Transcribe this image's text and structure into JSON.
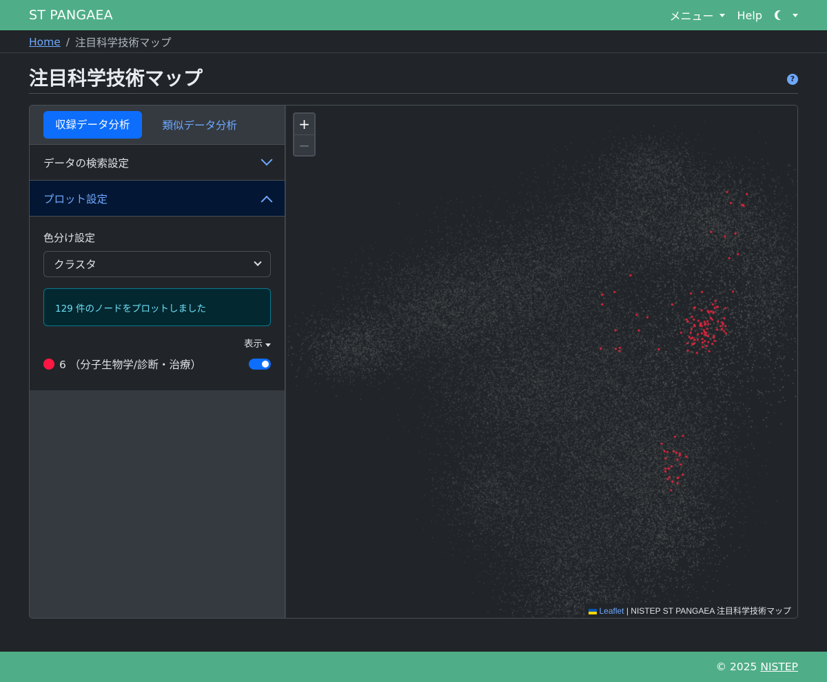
{
  "navbar": {
    "brand": "ST PANGAEA",
    "menu_label": "メニュー",
    "help_label": "Help",
    "theme_icon": "moon-icon"
  },
  "breadcrumb": {
    "home": "Home",
    "separator": "/",
    "current": "注目科学技術マップ"
  },
  "page": {
    "title": "注目科学技術マップ",
    "help_icon": "question-circle-icon",
    "help_glyph": "?"
  },
  "sidebar": {
    "tabs": [
      {
        "label": "収録データ分析",
        "active": true
      },
      {
        "label": "類似データ分析",
        "active": false
      }
    ],
    "accordion": [
      {
        "label": "データの検索設定",
        "open": false
      },
      {
        "label": "プロット設定",
        "open": true
      }
    ],
    "plot_settings": {
      "color_label": "色分け設定",
      "color_value": "クラスタ",
      "alert": "129 件のノードをプロットしました",
      "display_label": "表示",
      "legend": [
        {
          "label": "6 （分子生物学/診断・治療）",
          "color": "#ff1744",
          "enabled": true
        }
      ]
    }
  },
  "map": {
    "zoom_in": "+",
    "zoom_out": "−",
    "attribution_link": "Leaflet",
    "attribution_text": " | NISTEP ST PANGAEA 注目科学技術マップ",
    "background_point_color": "#5a5a5a",
    "highlight_point_color": "#e8263f",
    "highlighted_node_count": 129
  },
  "footer": {
    "copyright": "© 2025",
    "link": "NISTEP"
  },
  "colors": {
    "navbar": "#4fae87",
    "background": "#212529",
    "primary": "#0d6efd"
  }
}
